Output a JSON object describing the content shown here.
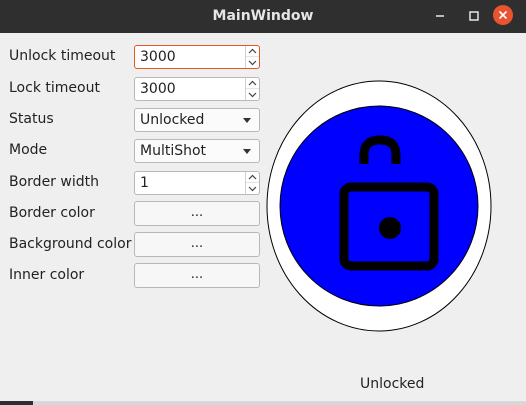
{
  "window": {
    "title": "MainWindow"
  },
  "form": {
    "unlock_timeout": {
      "label": "Unlock timeout",
      "value": "3000"
    },
    "lock_timeout": {
      "label": "Lock timeout",
      "value": "3000"
    },
    "status": {
      "label": "Status",
      "value": "Unlocked"
    },
    "mode": {
      "label": "Mode",
      "value": "MultiShot"
    },
    "border_width": {
      "label": "Border width",
      "value": "1"
    },
    "border_color": {
      "label": "Border color",
      "button": "..."
    },
    "background_color": {
      "label": "Background color",
      "button": "..."
    },
    "inner_color": {
      "label": "Inner color",
      "button": "..."
    }
  },
  "preview": {
    "icon": "unlocked-padlock-icon",
    "outer_fill": "#ffffff",
    "inner_fill": "#0000ff",
    "border_color": "#000000",
    "icon_color": "#000000"
  },
  "status_text": "Unlocked",
  "colors": {
    "titlebar": "#2f2f2f",
    "close": "#e9532f",
    "focus": "#e95420"
  }
}
